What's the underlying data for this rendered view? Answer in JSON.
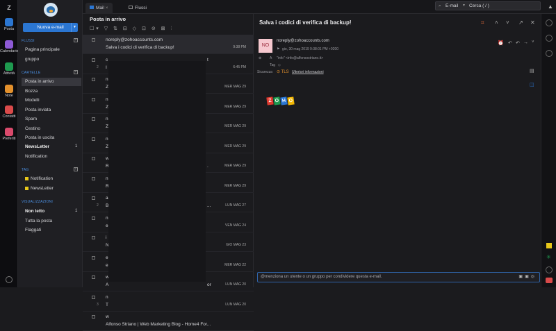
{
  "rail": {
    "logo": "Z",
    "items": [
      {
        "label": "Posta",
        "color": "#2b76d2"
      },
      {
        "label": "Calendario",
        "color": "#8e5ad6"
      },
      {
        "label": "Attività",
        "color": "#1e9a4f"
      },
      {
        "label": "Note",
        "color": "#e3902c"
      },
      {
        "label": "Contatti",
        "color": "#d94a4a"
      },
      {
        "label": "Preferiti",
        "color": "#d94a6c"
      }
    ]
  },
  "sidebar": {
    "new_mail": "Nuova e-mail",
    "sections": {
      "flows": "FLUSSI",
      "folders": "CARTELLE",
      "tags": "TAG",
      "views": "VISUALIZZAZIONI"
    },
    "flows": [
      "Pagina principale",
      "gruppo"
    ],
    "folders": [
      {
        "label": "Posta in arrivo",
        "count": ""
      },
      {
        "label": "Bozza",
        "count": ""
      },
      {
        "label": "Modelli",
        "count": ""
      },
      {
        "label": "Posta inviata",
        "count": ""
      },
      {
        "label": "Spam",
        "count": ""
      },
      {
        "label": "Cestino",
        "count": ""
      },
      {
        "label": "Posta in uscita",
        "count": ""
      },
      {
        "label": "NewsLetter",
        "count": "1"
      },
      {
        "label": "Notification",
        "count": ""
      }
    ],
    "tags": [
      "Notification",
      "NewsLetter"
    ],
    "views": [
      {
        "label": "Non letto",
        "count": "1"
      },
      {
        "label": "Tutta la posta",
        "count": ""
      },
      {
        "label": "Flaggati",
        "count": ""
      }
    ]
  },
  "tabs": [
    "Mail",
    "Flussi"
  ],
  "search": {
    "scope": "E-mail",
    "placeholder": "Cerca ( / )"
  },
  "list": {
    "title": "Posta in arrivo",
    "rows": [
      {
        "l1": "noreply@zohoaccounts.com",
        "l2": "Salva i codici di verifica di backup!",
        "date": "9:38 PM",
        "sm": ""
      },
      {
        "l1": "c",
        "l2": "I",
        "date": "6:45 PM",
        "sm": "2",
        "right1": "t"
      },
      {
        "l1": "n",
        "l2": "Z",
        "date": "MER MAG 29",
        "sm": ""
      },
      {
        "l1": "n",
        "l2": "Z",
        "date": "MER MAG 29",
        "sm": ""
      },
      {
        "l1": "n",
        "l2": "Z",
        "date": "MER MAG 29",
        "sm": ""
      },
      {
        "l1": "n",
        "l2": "Z",
        "date": "MER MAG 29",
        "sm": ""
      },
      {
        "l1": "w",
        "l2": "R",
        "date": "MER MAG 29",
        "sm": "",
        "right2": "."
      },
      {
        "l1": "n",
        "l2": "R",
        "date": "MER MAG 29",
        "sm": ""
      },
      {
        "l1": "a",
        "l2": "B",
        "date": "LUN MAG 27",
        "sm": "2",
        "right2": "..."
      },
      {
        "l1": "n",
        "l2": "e",
        "date": "VEN MAG 24",
        "sm": ""
      },
      {
        "l1": "i",
        "l2": "N",
        "date": "GIO MAG 23",
        "sm": ""
      },
      {
        "l1": "e",
        "l2": "e",
        "date": "MER MAG 22",
        "sm": ""
      },
      {
        "l1": "w",
        "l2": "A",
        "date": "LUN MAG 20",
        "sm": "",
        "right2": "or"
      },
      {
        "l1": "n",
        "l2": "T",
        "date": "LUN MAG 20",
        "sm": "3"
      },
      {
        "l1": "w",
        "l2": "Alfonso Striano | Web Marketing Blog - Home4 For...",
        "date": "",
        "sm": ""
      }
    ]
  },
  "reader": {
    "subject": "Salva i codici di verifica di backup!",
    "sender_initials": "NO",
    "sender": "noreply@zohoaccounts.com",
    "date": "gio, 30 mag 2019 9:38:01 PM +0200",
    "to_label": "A",
    "to": "\"info\" <info@alfonsostriano.it>",
    "tag_label": "Tag",
    "security_label": "Sicurezza",
    "tls": "TLS",
    "more_info": "Ulteriori informazioni",
    "zoho_letters": [
      {
        "ch": "Z",
        "color": "#e03a2f"
      },
      {
        "ch": "O",
        "color": "#1e9a4f"
      },
      {
        "ch": "H",
        "color": "#2b76d2"
      },
      {
        "ch": "O",
        "color": "#f2b705"
      }
    ],
    "reply_placeholder": "@menziona un utente o un gruppo per condividere questa e-mail."
  }
}
